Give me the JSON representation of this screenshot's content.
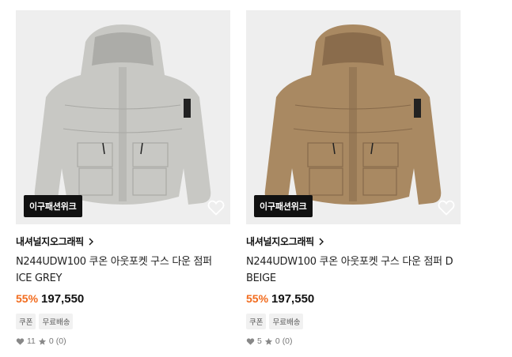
{
  "products": [
    {
      "badge": "이구패션위크",
      "brand": "내셔널지오그래픽",
      "name": "N244UDW100 쿠온 아웃포켓 구스 다운 점퍼 ICE GREY",
      "discount": "55%",
      "price": "197,550",
      "tags": [
        "쿠폰",
        "무료배송"
      ],
      "likes": "11",
      "rating": "0",
      "reviews": "(0)",
      "jacket_color": "#c8c8c4",
      "jacket_shadow": "#a9a9a5"
    },
    {
      "badge": "이구패션위크",
      "brand": "내셔널지오그래픽",
      "name": "N244UDW100 쿠온 아웃포켓 구스 다운 점퍼 D BEIGE",
      "discount": "55%",
      "price": "197,550",
      "tags": [
        "쿠폰",
        "무료배송"
      ],
      "likes": "5",
      "rating": "0",
      "reviews": "(0)",
      "jacket_color": "#a98962",
      "jacket_shadow": "#86694a"
    }
  ],
  "icons": {
    "wish": "heart-outline-icon",
    "brand_link": "chevron-right-icon",
    "likes": "heart-icon",
    "rating": "star-icon"
  },
  "colors": {
    "discount": "#f26b1d",
    "badge_bg": "#111111",
    "tag_bg": "#f1f1f1",
    "thumb_bg": "#eeeeee"
  }
}
